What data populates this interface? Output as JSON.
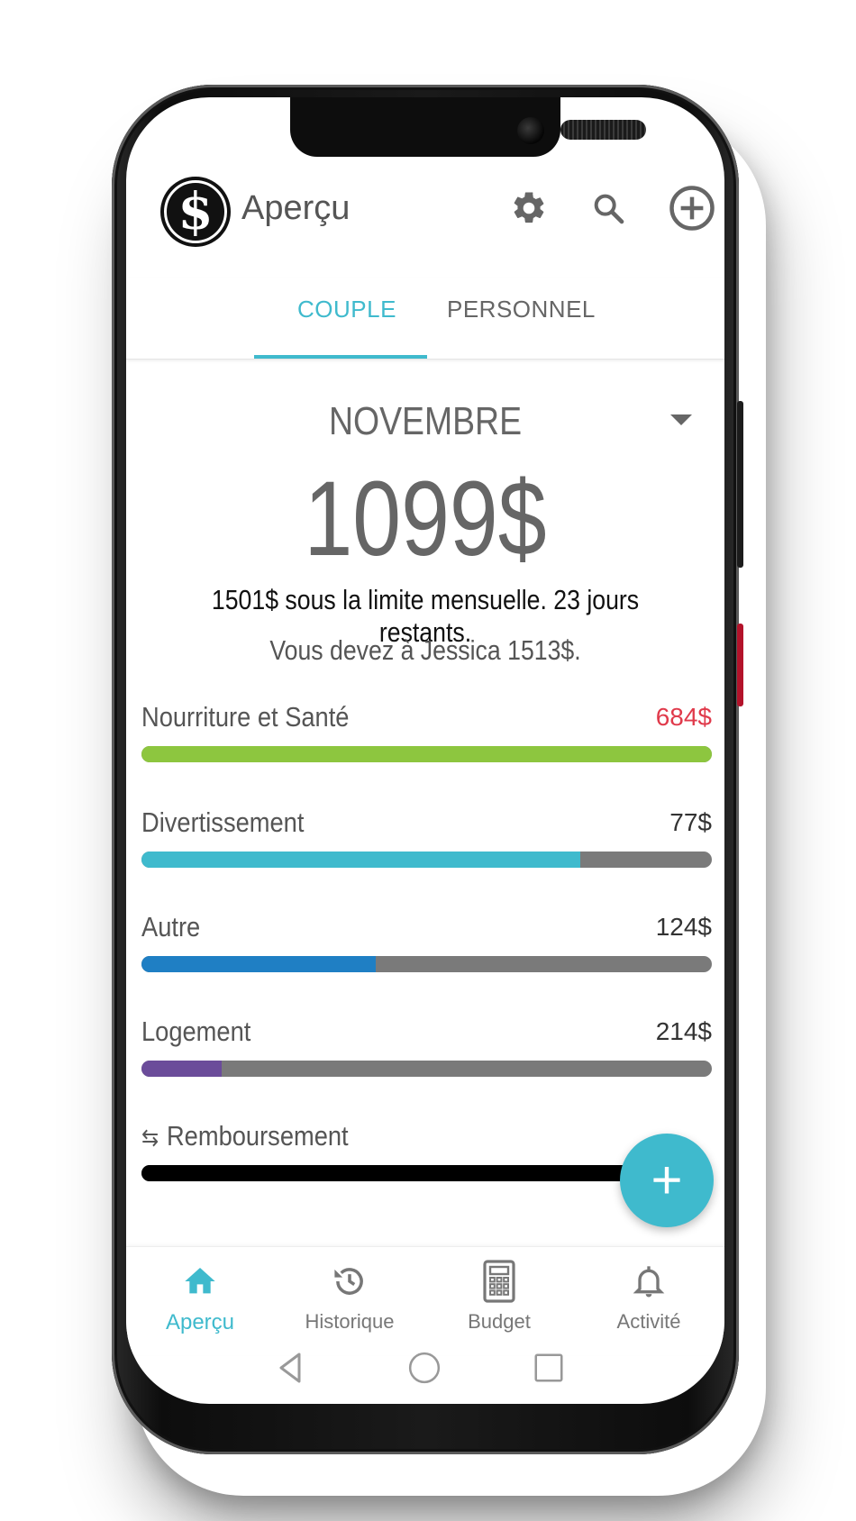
{
  "app": {
    "title": "Aperçu",
    "logo_symbol": "$"
  },
  "header_icons": [
    "gear-icon",
    "search-icon",
    "add-circle-icon"
  ],
  "tabs": [
    {
      "label": "COUPLE",
      "active": true
    },
    {
      "label": "PERSONNEL",
      "active": false
    }
  ],
  "summary": {
    "month": "NOVEMBRE",
    "total": "1099$",
    "limit_text": "1501$ sous la limite mensuelle. 23 jours restants.",
    "owe_text": "Vous devez à Jessica 1513$."
  },
  "categories": [
    {
      "name": "Nourriture et Santé",
      "amount": "684$",
      "amount_color": "#e03a4b",
      "fill_fraction": 1.0,
      "color": "#8dc63f"
    },
    {
      "name": "Divertissement",
      "amount": "77$",
      "amount_color": "#333333",
      "fill_fraction": 0.77,
      "color": "#3fbacd"
    },
    {
      "name": "Autre",
      "amount": "124$",
      "amount_color": "#333333",
      "fill_fraction": 0.41,
      "color": "#1f7fc4"
    },
    {
      "name": "Logement",
      "amount": "214$",
      "amount_color": "#333333",
      "fill_fraction": 0.14,
      "color": "#6b4c9a"
    },
    {
      "name": "Remboursement",
      "amount": "",
      "amount_color": "#333333",
      "fill_fraction": 1.0,
      "color": "#000000",
      "icon": "swap-arrows-icon"
    }
  ],
  "fab": {
    "label": "+"
  },
  "bottom_nav": [
    {
      "label": "Aperçu",
      "icon": "home-icon",
      "active": true
    },
    {
      "label": "Historique",
      "icon": "history-icon",
      "active": false
    },
    {
      "label": "Budget",
      "icon": "calculator-icon",
      "active": false
    },
    {
      "label": "Activité",
      "icon": "bell-icon",
      "active": false
    }
  ],
  "colors": {
    "accent": "#3fbacd",
    "text_muted": "#666666"
  }
}
